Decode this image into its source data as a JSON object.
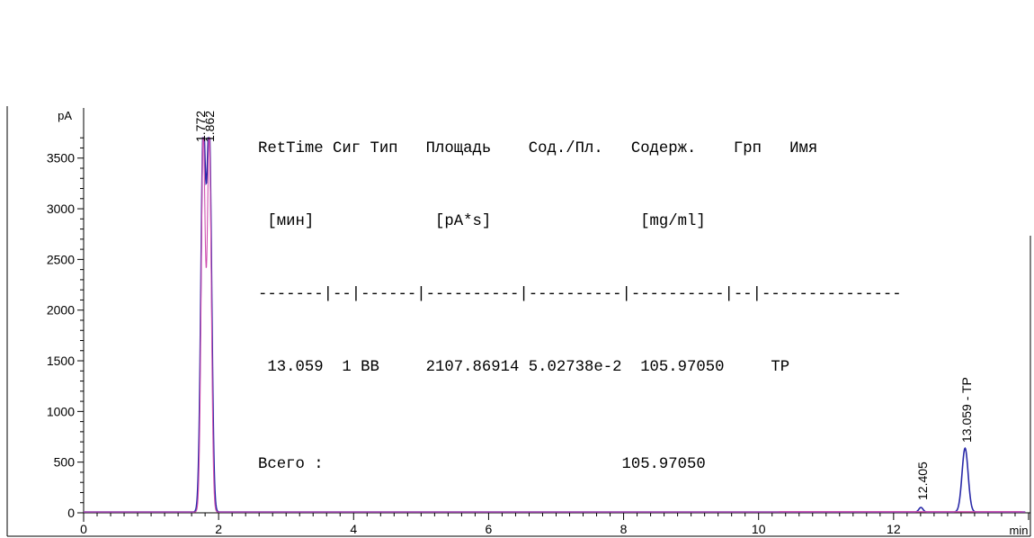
{
  "chart_data": {
    "type": "line",
    "xlabel": "min",
    "ylabel": "pA",
    "xlim": [
      0,
      14
    ],
    "ylim": [
      0,
      3700
    ],
    "x_ticks": [
      0,
      2,
      4,
      6,
      8,
      10,
      12
    ],
    "y_ticks": [
      0,
      500,
      1000,
      1500,
      2000,
      2500,
      3000,
      3500
    ],
    "grid": false,
    "legend": "none",
    "series": [
      {
        "color": "#2a2aa8",
        "peaks": [
          {
            "rt": 1.772,
            "height": 3700,
            "width": 0.035
          },
          {
            "rt": 1.862,
            "height": 3700,
            "width": 0.035
          },
          {
            "rt": 12.405,
            "height": 45,
            "width": 0.03
          },
          {
            "rt": 13.059,
            "height": 630,
            "width": 0.045
          }
        ]
      },
      {
        "color": "#d04fb0",
        "peaks": [
          {
            "rt": 1.772,
            "height": 3700,
            "width": 0.03
          },
          {
            "rt": 1.862,
            "height": 3700,
            "width": 0.03
          }
        ]
      }
    ],
    "annotations": [
      {
        "x": 1.772,
        "text": "1.772"
      },
      {
        "x": 1.862,
        "text": "1.862"
      },
      {
        "x": 12.405,
        "text": "12.405"
      },
      {
        "x": 13.059,
        "text": "13.059 -  TP"
      }
    ]
  },
  "report": {
    "header_line1": "RetTime Сиг Тип   Площадь    Сод./Пл.   Содерж.    Грп   Имя",
    "header_line2": " [мин]             [pA*s]                [mg/ml]",
    "separator": "-------|--|------|----------|----------|----------|--|---------------",
    "row1": " 13.059  1 BB     2107.86914 5.02738e-2  105.97050     TP",
    "total": "Всего :                                105.97050"
  },
  "colors": {
    "signal": "#2a2aa8",
    "baseline": "#d04fb0",
    "axis": "#000000"
  }
}
